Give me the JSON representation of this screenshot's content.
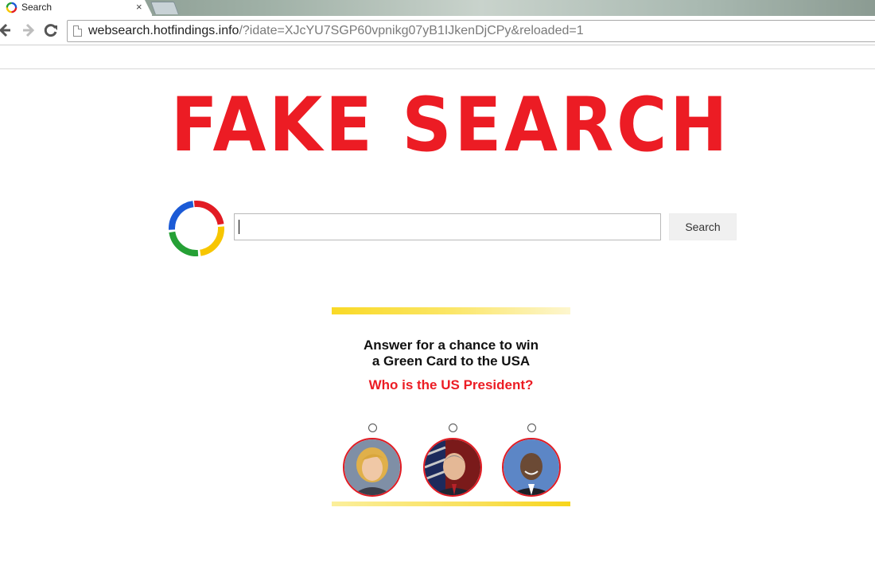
{
  "browser": {
    "tab": {
      "title": "Search",
      "close_glyph": "×"
    },
    "url_host": "websearch.hotfindings.info",
    "url_path": "/?idate=XJcYU7SGP60vpnikg07yB1IJkenDjCPy&reloaded=1",
    "icons": {
      "back": "arrow-left-icon",
      "forward": "arrow-right-icon",
      "reload": "reload-icon",
      "page": "page-icon",
      "favicon": "ring-logo-icon"
    }
  },
  "page": {
    "headline": "FAKE SEARCH",
    "search": {
      "button_label": "Search",
      "value": ""
    },
    "logo_colors": [
      "#e21b23",
      "#f7c600",
      "#25a035",
      "#1b5ad6"
    ]
  },
  "quiz": {
    "line1": "Answer for a chance to win",
    "line2": "a Green Card to the USA",
    "question": "Who is the US President?",
    "choices": [
      {
        "icon": "portrait-woman-icon",
        "selected": false
      },
      {
        "icon": "portrait-man-flag-icon",
        "selected": false
      },
      {
        "icon": "portrait-man-icon",
        "selected": false
      }
    ]
  },
  "colors": {
    "accent_red": "#ec1c24",
    "yellow_bar": "#f9d926"
  }
}
